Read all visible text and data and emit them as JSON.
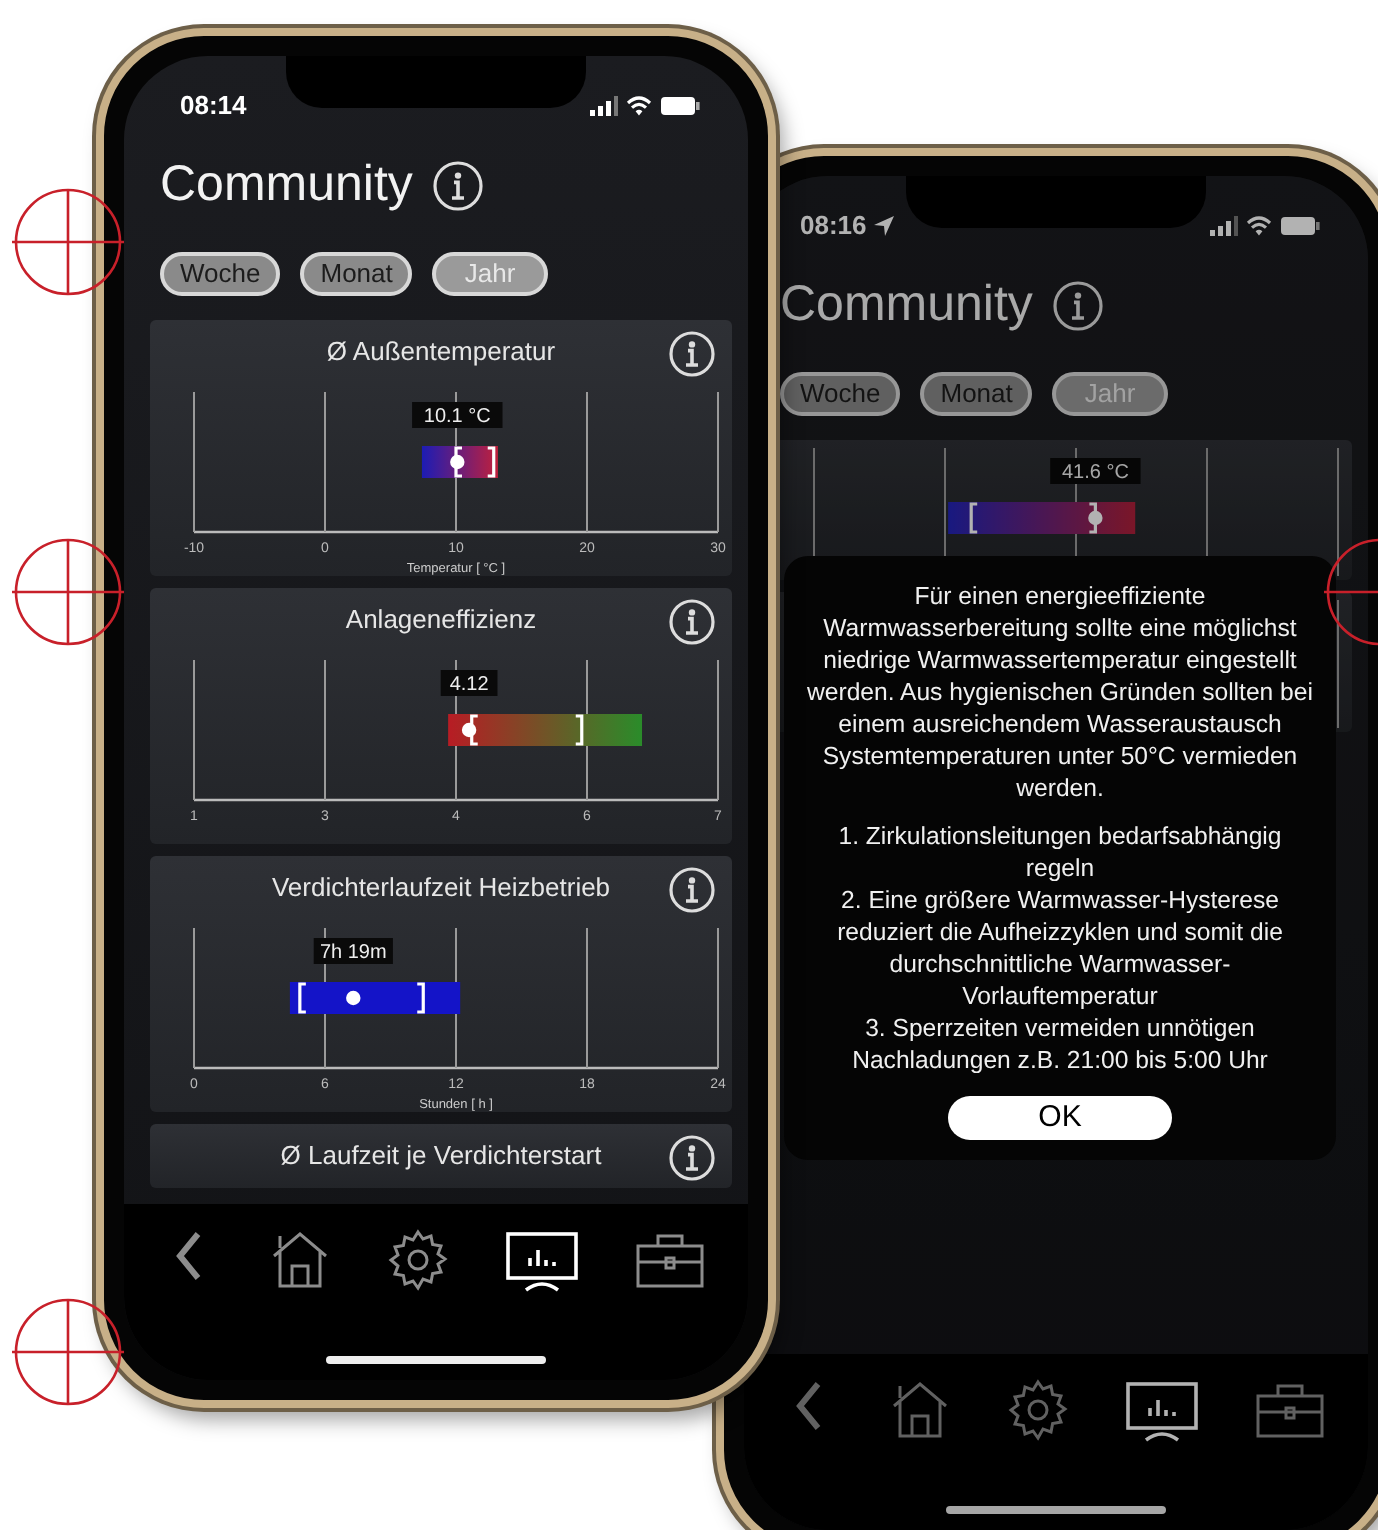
{
  "phones": [
    {
      "status_time": "08:14",
      "location_arrow": false,
      "title": "Community",
      "periods": [
        {
          "label": "Woche",
          "selected": false
        },
        {
          "label": "Monat",
          "selected": false
        },
        {
          "label": "Jahr",
          "selected": true
        }
      ],
      "cards": [
        {
          "kind": "temperature",
          "title": "Ø Außentemperatur",
          "tick_labels": [
            "-10",
            "0",
            "10",
            "20",
            "30"
          ],
          "axis_title": "Temperatur [ °C ]",
          "value_label": "10.1 °C"
        },
        {
          "kind": "efficiency",
          "title": "Anlageneffizienz",
          "tick_labels": [
            "1",
            "3",
            "4",
            "6",
            "7"
          ],
          "value_label": "4.12"
        },
        {
          "kind": "runtime",
          "title": "Verdichterlaufzeit Heizbetrieb",
          "tick_labels": [
            "0",
            "6",
            "12",
            "18",
            "24"
          ],
          "axis_title": "Stunden [ h ]",
          "value_label": "7h 19m"
        },
        {
          "kind": "heading",
          "title": "Ø Laufzeit je Verdichterstart"
        }
      ],
      "nav": [
        {
          "kind": "back",
          "selected": false
        },
        {
          "kind": "home",
          "selected": false
        },
        {
          "kind": "settings",
          "selected": false
        },
        {
          "kind": "monitor",
          "selected": true
        },
        {
          "kind": "toolbox",
          "selected": false
        }
      ]
    },
    {
      "status_time": "08:16",
      "location_arrow": true,
      "title": "Community",
      "periods": [
        {
          "label": "Woche",
          "selected": false
        },
        {
          "label": "Monat",
          "selected": false
        },
        {
          "label": "Jahr",
          "selected": true
        }
      ],
      "cards": [
        {
          "kind": "hotwater",
          "value_label": "41.6 °C"
        },
        {
          "kind": "partial"
        }
      ],
      "nav": [
        {
          "kind": "back",
          "selected": false
        },
        {
          "kind": "home",
          "selected": false
        },
        {
          "kind": "settings",
          "selected": false
        },
        {
          "kind": "monitor",
          "selected": true
        },
        {
          "kind": "toolbox",
          "selected": false
        }
      ],
      "dialog": {
        "message": "Für einen energieeffiziente Warmwasserbereitung sollte eine möglichst niedrige Warmwassertemperatur eingestellt werden. Aus hygienischen Gründen sollten bei einem ausreichendem Wasseraustausch Systemtemperaturen unter 50°C vermieden werden.",
        "tips": [
          "1. Zirkulationsleitungen bedarfsabhängig regeln",
          "2. Eine größere Warmwasser-Hysterese reduziert die Aufheizzyklen und somit die durchschnittliche Warmwasser-Vorlauftemperatur",
          "3. Sperrzeiten vermeiden unnötigen Nachladungen z.B. 21:00 bis 5:00 Uhr"
        ],
        "button": "OK"
      }
    }
  ]
}
